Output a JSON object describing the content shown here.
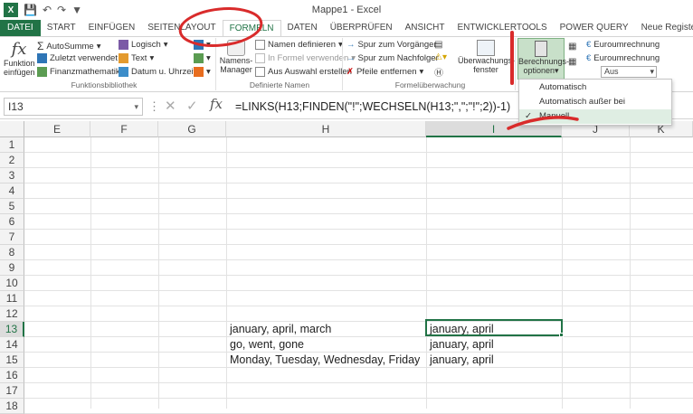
{
  "title": "Mappe1 - Excel",
  "tabs": [
    "DATEI",
    "START",
    "EINFÜGEN",
    "SEITENLAYOUT",
    "FORMELN",
    "DATEN",
    "ÜBERPRÜFEN",
    "ANSICHT",
    "ENTWICKLERTOOLS",
    "POWER QUERY",
    "Neue Registerkarte"
  ],
  "ribbon": {
    "insert_function": "Funktion\neinfügen",
    "insert_function_l1": "Funktion",
    "insert_function_l2": "einfügen",
    "autosum": "AutoSumme",
    "recent": "Zuletzt verwendet",
    "financial": "Finanzmathematik",
    "logical": "Logisch",
    "text": "Text",
    "datetime": "Datum u. Uhrzeit",
    "group_library": "Funktionsbibliothek",
    "name_manager_l1": "Namens-",
    "name_manager_l2": "Manager",
    "define_name": "Namen definieren",
    "use_in_formula": "In Formel verwenden",
    "create_from_selection": "Aus Auswahl erstellen",
    "group_names": "Definierte Namen",
    "trace_precedents": "Spur zum Vorgänger",
    "trace_dependents": "Spur zum Nachfolger",
    "remove_arrows": "Pfeile entfernen",
    "group_auditing": "Formelüberwachung",
    "watch_l1": "Überwachungs-",
    "watch_l2": "fenster",
    "calc_l1": "Berechnungs-",
    "calc_l2": "optionen",
    "euro1": "Euroumrechnung",
    "euro2": "Euroumrechnung",
    "aus": "Aus"
  },
  "calc_menu": [
    "Automatisch",
    "Automatisch außer bei Datentabellen",
    "Manuell"
  ],
  "namebox": "I13",
  "formula": "=LINKS(H13;FINDEN(\"!\";WECHSELN(H13;\",\";\"!\";2))-1)",
  "columns": [
    "E",
    "F",
    "G",
    "H",
    "I",
    "J",
    "K"
  ],
  "rows": [
    "1",
    "2",
    "3",
    "4",
    "5",
    "6",
    "7",
    "8",
    "9",
    "10",
    "11",
    "12",
    "13",
    "14",
    "15",
    "16",
    "17",
    "18"
  ],
  "cells": {
    "H13": "january, april, march",
    "H14": "go, went, gone",
    "H15": "Monday, Tuesday, Wednesday, Friday",
    "I13": "january, april",
    "I14": "january, april",
    "I15": "january, april"
  },
  "colors": {
    "excel_green": "#217346",
    "annotation_red": "#d92b2b"
  }
}
